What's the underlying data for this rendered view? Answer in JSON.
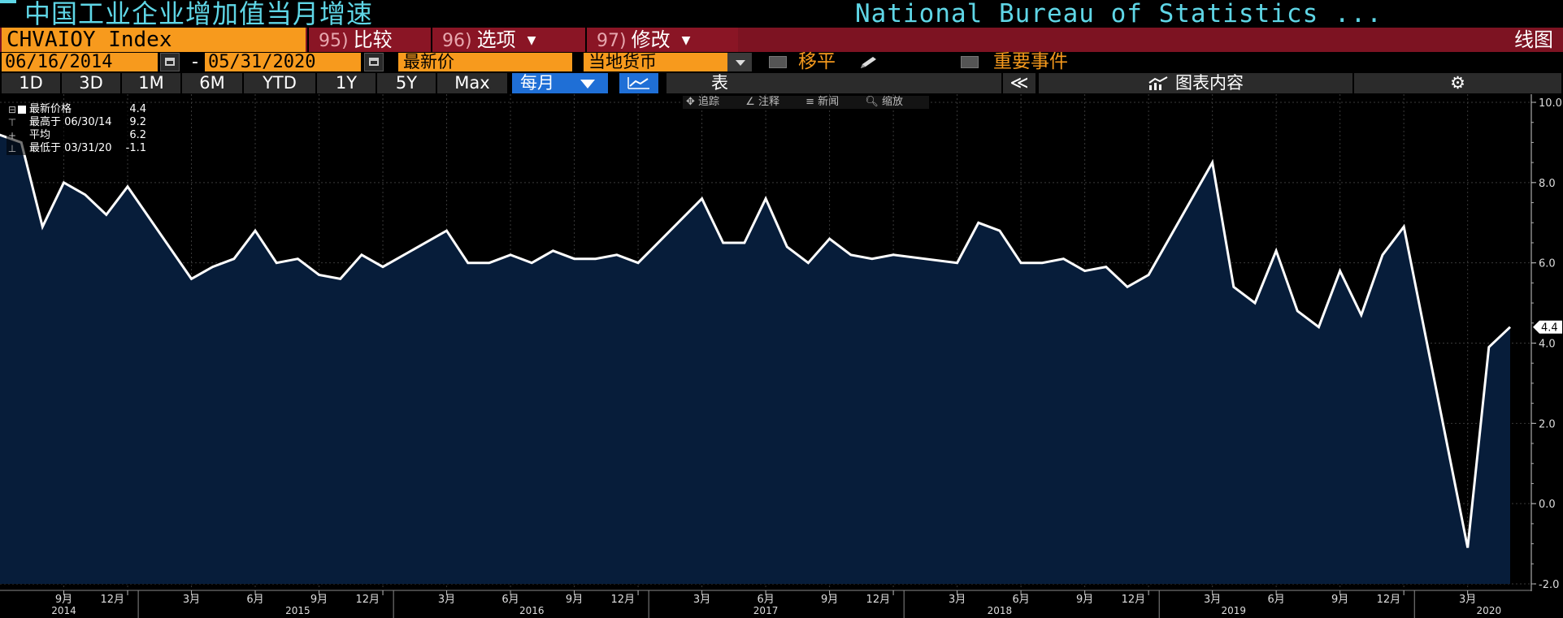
{
  "title": {
    "cn": "中国工业企业增加值当月增速",
    "source": "National Bureau of Statistics ..."
  },
  "menu": {
    "ticker": "CHVAIOY Index",
    "compare": {
      "num": "95)",
      "label": "比较"
    },
    "options": {
      "num": "96)",
      "label": "选项"
    },
    "modify": {
      "num": "97)",
      "label": "修改"
    },
    "chart_type": "线图"
  },
  "controls": {
    "start_date": "06/16/2014",
    "date_separator": "-",
    "end_date": "05/31/2020",
    "price_field": "最新价",
    "currency": "当地货币",
    "smoothing": "移平",
    "events": "重要事件"
  },
  "periods": [
    "1D",
    "3D",
    "1M",
    "6M",
    "YTD",
    "1Y",
    "5Y",
    "Max"
  ],
  "frequency": "每月",
  "table_label": "表",
  "collapse_label": "≪",
  "content_label": "图表内容",
  "mini_toolbar": [
    "追踪",
    "注释",
    "新闻",
    "缩放"
  ],
  "legend": [
    {
      "label": "最新价格",
      "value": "4.4"
    },
    {
      "label": "最高于 06/30/14",
      "value": "9.2"
    },
    {
      "label": "平均",
      "value": "6.2"
    },
    {
      "label": "最低于 03/31/20",
      "value": "-1.1"
    }
  ],
  "colors": {
    "background": "#000000",
    "area": "#071d3a",
    "line": "#ffffff",
    "title": "#5fd6e6",
    "orange": "#f79a1d",
    "menu_red": "#7d1322",
    "button_blue": "#1f6fd6"
  },
  "chart_data": {
    "type": "area",
    "x": [
      "2014-06",
      "2014-07",
      "2014-08",
      "2014-09",
      "2014-10",
      "2014-11",
      "2014-12",
      "2015-03",
      "2015-04",
      "2015-05",
      "2015-06",
      "2015-07",
      "2015-08",
      "2015-09",
      "2015-10",
      "2015-11",
      "2015-12",
      "2016-03",
      "2016-04",
      "2016-05",
      "2016-06",
      "2016-07",
      "2016-08",
      "2016-09",
      "2016-10",
      "2016-11",
      "2016-12",
      "2017-03",
      "2017-04",
      "2017-05",
      "2017-06",
      "2017-07",
      "2017-08",
      "2017-09",
      "2017-10",
      "2017-11",
      "2017-12",
      "2018-03",
      "2018-04",
      "2018-05",
      "2018-06",
      "2018-07",
      "2018-08",
      "2018-09",
      "2018-10",
      "2018-11",
      "2018-12",
      "2019-03",
      "2019-04",
      "2019-05",
      "2019-06",
      "2019-07",
      "2019-08",
      "2019-09",
      "2019-10",
      "2019-11",
      "2019-12",
      "2020-03",
      "2020-04",
      "2020-05"
    ],
    "series": [
      {
        "values": [
          9.2,
          9.0,
          6.9,
          8.0,
          7.7,
          7.2,
          7.9,
          5.6,
          5.9,
          6.1,
          6.8,
          6.0,
          6.1,
          5.7,
          5.6,
          6.2,
          5.9,
          6.8,
          6.0,
          6.0,
          6.2,
          6.0,
          6.3,
          6.1,
          6.1,
          6.2,
          6.0,
          7.6,
          6.5,
          6.5,
          7.6,
          6.4,
          6.0,
          6.6,
          6.2,
          6.1,
          6.2,
          6.0,
          7.0,
          6.8,
          6.0,
          6.0,
          6.1,
          5.8,
          5.9,
          5.4,
          5.7,
          8.5,
          5.4,
          5.0,
          6.3,
          4.8,
          4.4,
          5.8,
          4.7,
          6.2,
          6.9,
          -1.1,
          3.9,
          4.4
        ]
      }
    ],
    "ylim": [
      -2.0,
      10.0
    ],
    "y_ticks": [
      "10.0",
      "8.0",
      "6.0",
      "4.0",
      "2.0",
      "0.0",
      "-2.0"
    ],
    "last_value_label": "4.4",
    "x_tick_labels": [
      {
        "x": "2014-09",
        "label": "9月"
      },
      {
        "x": "2014-12",
        "label": "12月"
      },
      {
        "x": "2015-03",
        "label": "3月"
      },
      {
        "x": "2015-06",
        "label": "6月"
      },
      {
        "x": "2015-09",
        "label": "9月"
      },
      {
        "x": "2015-12",
        "label": "12月"
      },
      {
        "x": "2016-03",
        "label": "3月"
      },
      {
        "x": "2016-06",
        "label": "6月"
      },
      {
        "x": "2016-09",
        "label": "9月"
      },
      {
        "x": "2016-12",
        "label": "12月"
      },
      {
        "x": "2017-03",
        "label": "3月"
      },
      {
        "x": "2017-06",
        "label": "6月"
      },
      {
        "x": "2017-09",
        "label": "9月"
      },
      {
        "x": "2017-12",
        "label": "12月"
      },
      {
        "x": "2018-03",
        "label": "3月"
      },
      {
        "x": "2018-06",
        "label": "6月"
      },
      {
        "x": "2018-09",
        "label": "9月"
      },
      {
        "x": "2018-12",
        "label": "12月"
      },
      {
        "x": "2019-03",
        "label": "3月"
      },
      {
        "x": "2019-06",
        "label": "6月"
      },
      {
        "x": "2019-09",
        "label": "9月"
      },
      {
        "x": "2019-12",
        "label": "12月"
      },
      {
        "x": "2020-03",
        "label": "3月"
      }
    ],
    "year_labels": [
      {
        "x": "2014-09",
        "label": "2014"
      },
      {
        "x": "2015-08",
        "label": "2015"
      },
      {
        "x": "2016-07",
        "label": "2016"
      },
      {
        "x": "2017-06",
        "label": "2017"
      },
      {
        "x": "2018-05",
        "label": "2018"
      },
      {
        "x": "2019-04",
        "label": "2019"
      },
      {
        "x": "2020-04",
        "label": "2020"
      }
    ],
    "grid": true
  }
}
